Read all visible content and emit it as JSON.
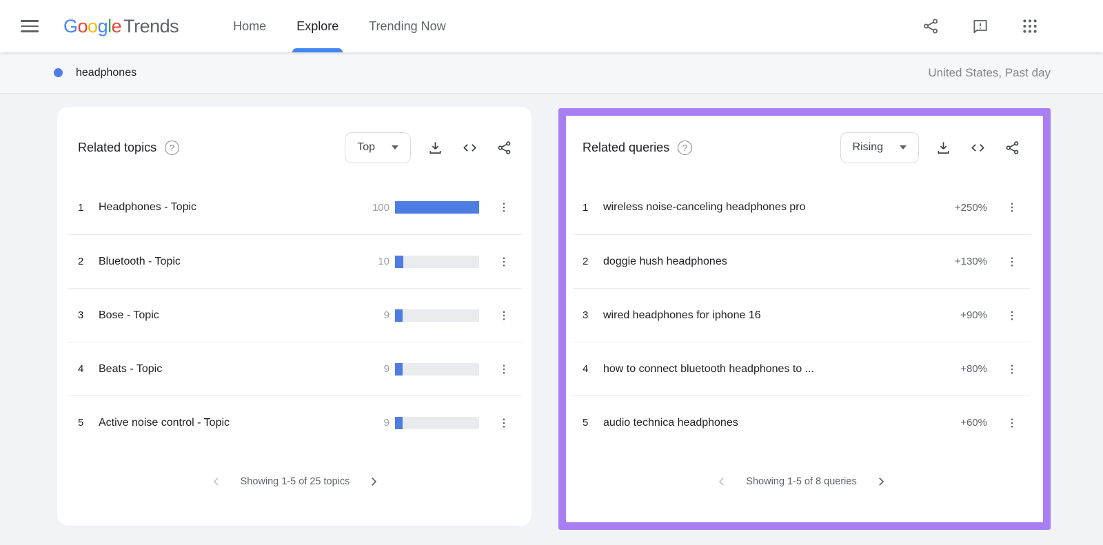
{
  "colors": {
    "accent_blue": "#4285f4",
    "bar_blue": "#4d7ce2",
    "highlight_purple": "#a87ff2",
    "logo_letter_colors": [
      "#4285F4",
      "#EA4335",
      "#FBBC05",
      "#4285F4",
      "#34A853",
      "#EA4335"
    ]
  },
  "nav": {
    "logo": {
      "google_letters": [
        "G",
        "o",
        "o",
        "g",
        "l",
        "e"
      ],
      "suffix": "Trends"
    },
    "tabs": [
      {
        "label": "Home",
        "active": false
      },
      {
        "label": "Explore",
        "active": true
      },
      {
        "label": "Trending Now",
        "active": false
      }
    ],
    "icons": [
      "share-icon",
      "feedback-icon",
      "google-apps-icon"
    ]
  },
  "term_bar": {
    "term": "headphones",
    "scope": "United States, Past day"
  },
  "related_topics": {
    "title": "Related topics",
    "help_glyph": "?",
    "filter_value": "Top",
    "rows": [
      {
        "rank": "1",
        "label": "Headphones - Topic",
        "value": "100",
        "bar_percent": 100
      },
      {
        "rank": "2",
        "label": "Bluetooth - Topic",
        "value": "10",
        "bar_percent": 10
      },
      {
        "rank": "3",
        "label": "Bose - Topic",
        "value": "9",
        "bar_percent": 9
      },
      {
        "rank": "4",
        "label": "Beats - Topic",
        "value": "9",
        "bar_percent": 9
      },
      {
        "rank": "5",
        "label": "Active noise control - Topic",
        "value": "9",
        "bar_percent": 9
      }
    ],
    "pagination": "Showing 1-5 of 25 topics"
  },
  "related_queries": {
    "title": "Related queries",
    "help_glyph": "?",
    "filter_value": "Rising",
    "rows": [
      {
        "rank": "1",
        "label": "wireless noise-canceling headphones pro",
        "value": "+250%"
      },
      {
        "rank": "2",
        "label": "doggie hush headphones",
        "value": "+130%"
      },
      {
        "rank": "3",
        "label": "wired headphones for iphone 16",
        "value": "+90%"
      },
      {
        "rank": "4",
        "label": "how to connect bluetooth headphones to ...",
        "value": "+80%"
      },
      {
        "rank": "5",
        "label": "audio technica headphones",
        "value": "+60%"
      }
    ],
    "pagination": "Showing 1-5 of 8 queries"
  }
}
